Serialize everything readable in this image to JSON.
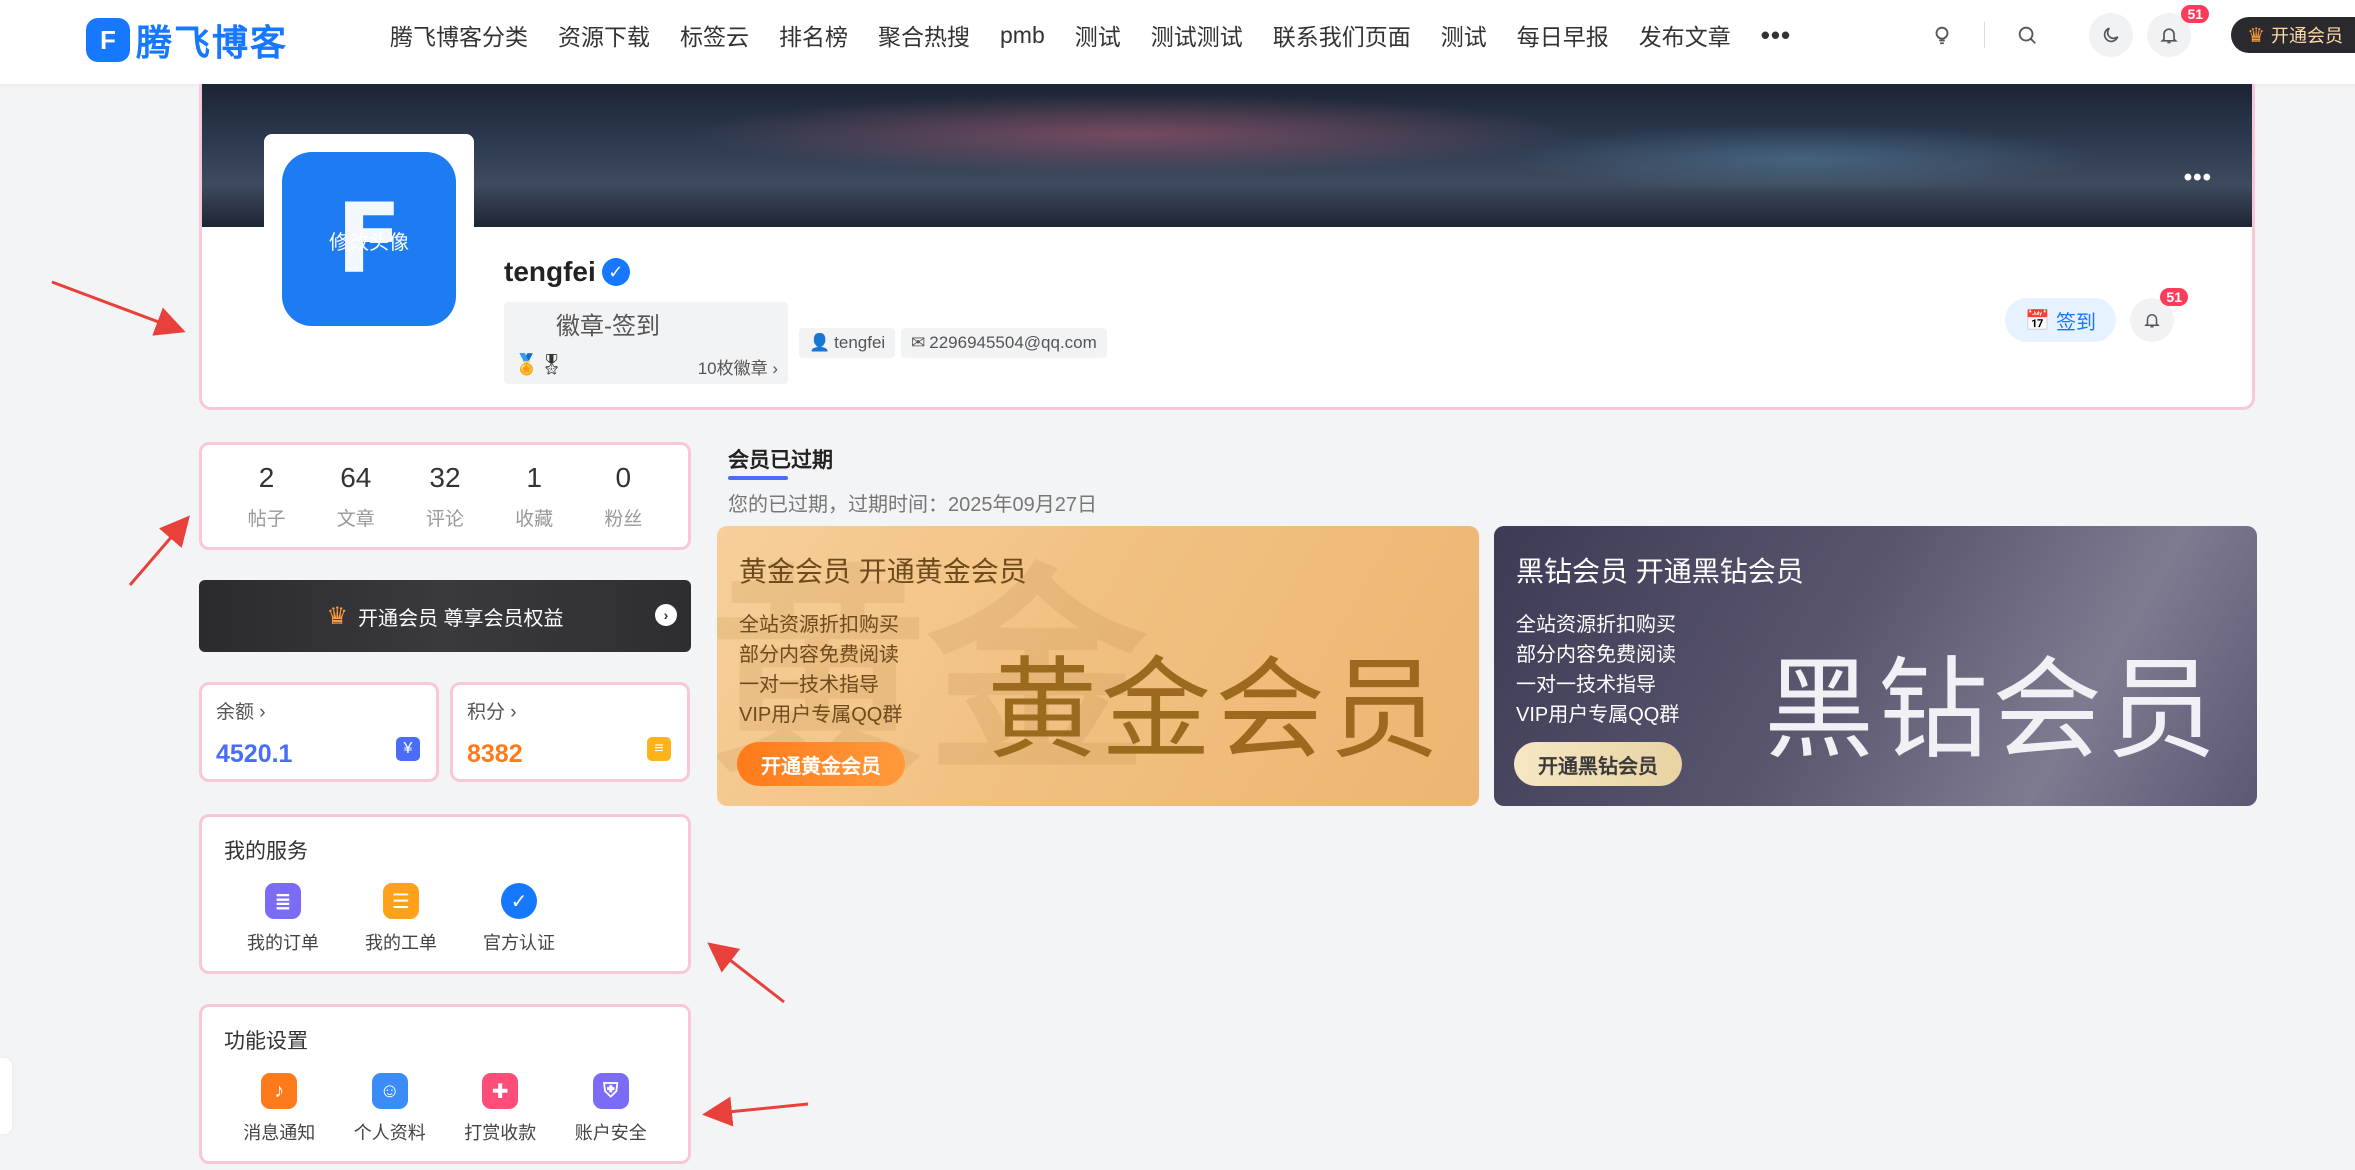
{
  "header": {
    "logo_mark": "F",
    "logo_text": "腾飞博客",
    "nav": [
      "腾飞博客分类",
      "资源下载",
      "标签云",
      "排名榜",
      "聚合热搜",
      "pmb",
      "测试",
      "测试测试",
      "联系我们页面",
      "测试",
      "每日早报",
      "发布文章"
    ],
    "more": "•••",
    "notify_badge": "51",
    "vip_label": "开通会员"
  },
  "profile": {
    "avatar_edit": "修改头像",
    "username": "tengfei",
    "medal_alt": "徽章-签到",
    "medal_count": "10枚徽章 ›",
    "tag_user": "tengfei",
    "tag_email": "2296945504@qq.com",
    "checkin_label": "签到",
    "bell_badge": "51"
  },
  "stats": [
    {
      "num": "2",
      "label": "帖子"
    },
    {
      "num": "64",
      "label": "文章"
    },
    {
      "num": "32",
      "label": "评论"
    },
    {
      "num": "1",
      "label": "收藏"
    },
    {
      "num": "0",
      "label": "粉丝"
    }
  ],
  "vip_banner": {
    "label": "开通会员 尊享会员权益"
  },
  "balance": {
    "label": "余额 ›",
    "value": "4520.1",
    "icon": "¥",
    "color": "#4a6cf7"
  },
  "points": {
    "label": "积分 ›",
    "value": "8382",
    "color": "#ff7a1a"
  },
  "services": {
    "title": "我的服务",
    "items": [
      {
        "label": "我的订单",
        "icon": "order-icon",
        "color": "#7b6cf6"
      },
      {
        "label": "我的工单",
        "icon": "ticket-icon",
        "color": "#ffa21a"
      },
      {
        "label": "官方认证",
        "icon": "verified-icon",
        "color": "#1677ff"
      }
    ]
  },
  "settings": {
    "title": "功能设置",
    "items": [
      {
        "label": "消息通知",
        "icon": "bell-icon",
        "color": "#ff7a1a"
      },
      {
        "label": "个人资料",
        "icon": "profile-icon",
        "color": "#3b8cf7"
      },
      {
        "label": "打赏收款",
        "icon": "gift-icon",
        "color": "#ff4d7a"
      },
      {
        "label": "账户安全",
        "icon": "shield-icon",
        "color": "#7b6cf6"
      }
    ]
  },
  "membership": {
    "title": "会员已过期",
    "subtitle": "您的已过期，过期时间：2025年09月27日",
    "gold": {
      "head": "黄金会员 开通黄金会员",
      "features": [
        "全站资源折扣购买",
        "部分内容免费阅读",
        "一对一技术指导",
        "VIP用户专属QQ群"
      ],
      "big": "黄金会员",
      "button": "开通黄金会员"
    },
    "black": {
      "head": "黑钻会员 开通黑钻会员",
      "features": [
        "全站资源折扣购买",
        "部分内容免费阅读",
        "一对一技术指导",
        "VIP用户专属QQ群"
      ],
      "big": "黑钻会员",
      "button": "开通黑钻会员"
    }
  }
}
